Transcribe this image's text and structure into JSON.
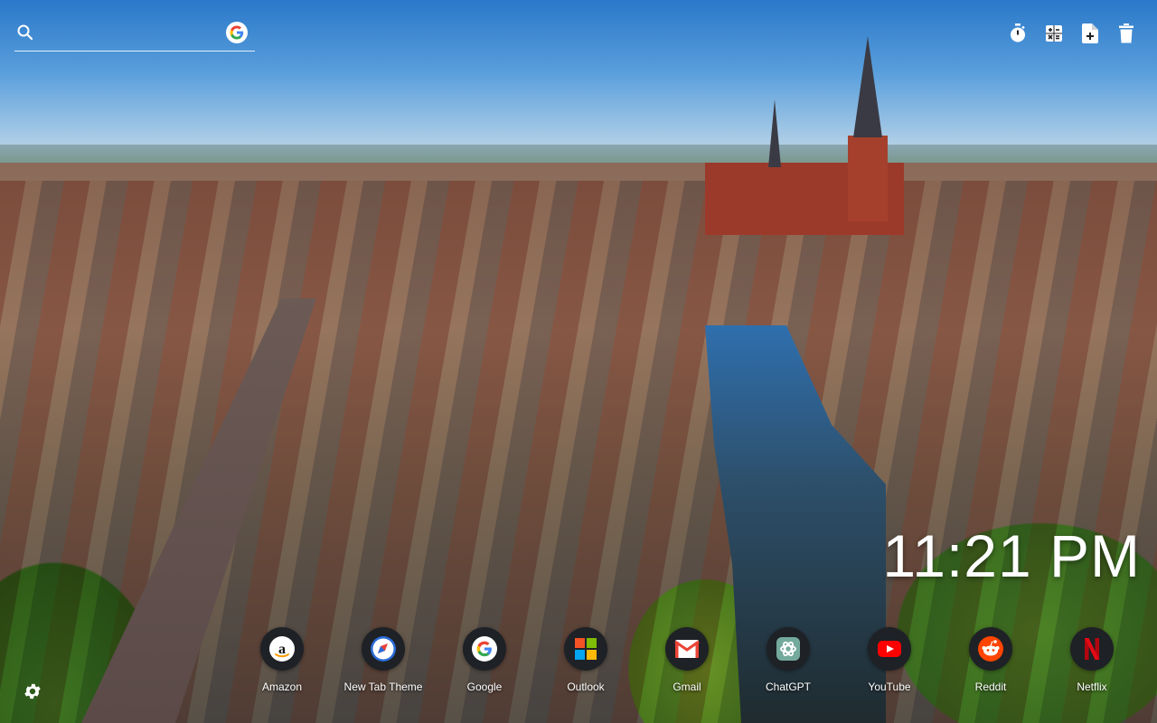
{
  "search": {
    "placeholder": "",
    "engine_icon": "google-icon"
  },
  "toolbar": {
    "items": [
      {
        "name": "timer",
        "icon": "stopwatch-icon"
      },
      {
        "name": "calculator",
        "icon": "calculator-icon"
      },
      {
        "name": "add-file",
        "icon": "file-plus-icon"
      },
      {
        "name": "delete",
        "icon": "trash-icon"
      }
    ]
  },
  "clock": {
    "time": "11:21 PM"
  },
  "shortcuts": [
    {
      "label": "Amazon",
      "icon": "amazon-icon"
    },
    {
      "label": "New Tab Theme",
      "icon": "compass-icon"
    },
    {
      "label": "Google",
      "icon": "google-icon"
    },
    {
      "label": "Outlook",
      "icon": "microsoft-icon"
    },
    {
      "label": "Gmail",
      "icon": "gmail-icon"
    },
    {
      "label": "ChatGPT",
      "icon": "chatgpt-icon"
    },
    {
      "label": "YouTube",
      "icon": "youtube-icon"
    },
    {
      "label": "Reddit",
      "icon": "reddit-icon"
    },
    {
      "label": "Netflix",
      "icon": "netflix-icon"
    }
  ],
  "settings": {
    "icon": "gear-icon"
  },
  "colors": {
    "youtube": "#ff0000",
    "netflix": "#e50914",
    "reddit": "#ff4500",
    "gmail": "#ea4335",
    "chatgpt": "#74aa9c",
    "tile_bg": "#1e2126"
  }
}
